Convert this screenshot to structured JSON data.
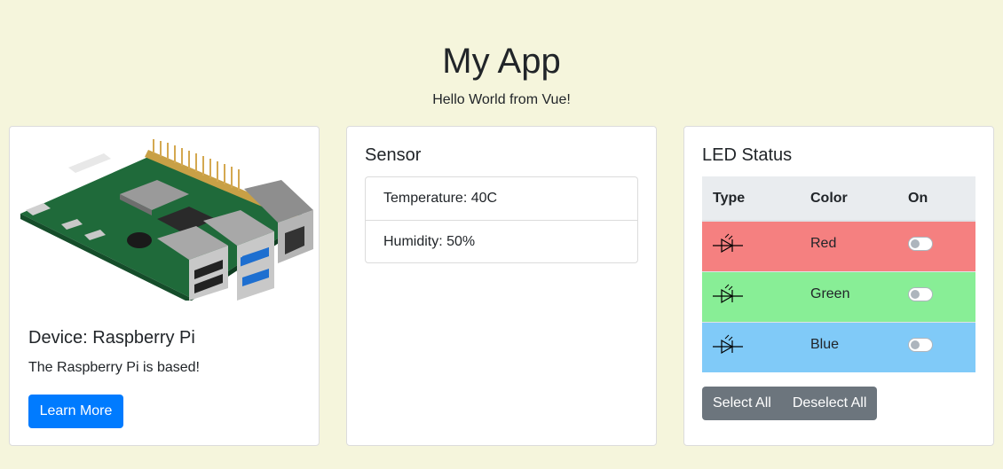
{
  "header": {
    "title": "My App",
    "subtitle": "Hello World from Vue!"
  },
  "device_card": {
    "image_icon": "raspberry-pi-board",
    "title": "Device: Raspberry Pi",
    "text": "The Raspberry Pi is based!",
    "button_label": "Learn More",
    "button_color": "#007bff"
  },
  "sensor_card": {
    "title": "Sensor",
    "items": [
      {
        "label": "Temperature: 40C"
      },
      {
        "label": "Humidity: 50%"
      }
    ]
  },
  "led_card": {
    "title": "LED Status",
    "columns": [
      "Type",
      "Color",
      "On"
    ],
    "rows": [
      {
        "icon": "led-icon",
        "color": "Red",
        "on": false,
        "row_color": "#f58080"
      },
      {
        "icon": "led-icon",
        "color": "Green",
        "on": false,
        "row_color": "#88ee96"
      },
      {
        "icon": "led-icon",
        "color": "Blue",
        "on": false,
        "row_color": "#80caf8"
      }
    ],
    "select_all_label": "Select All",
    "deselect_all_label": "Deselect All"
  },
  "colors": {
    "page_background": "#f5f5dc",
    "primary": "#007bff",
    "secondary": "#6c757d"
  }
}
